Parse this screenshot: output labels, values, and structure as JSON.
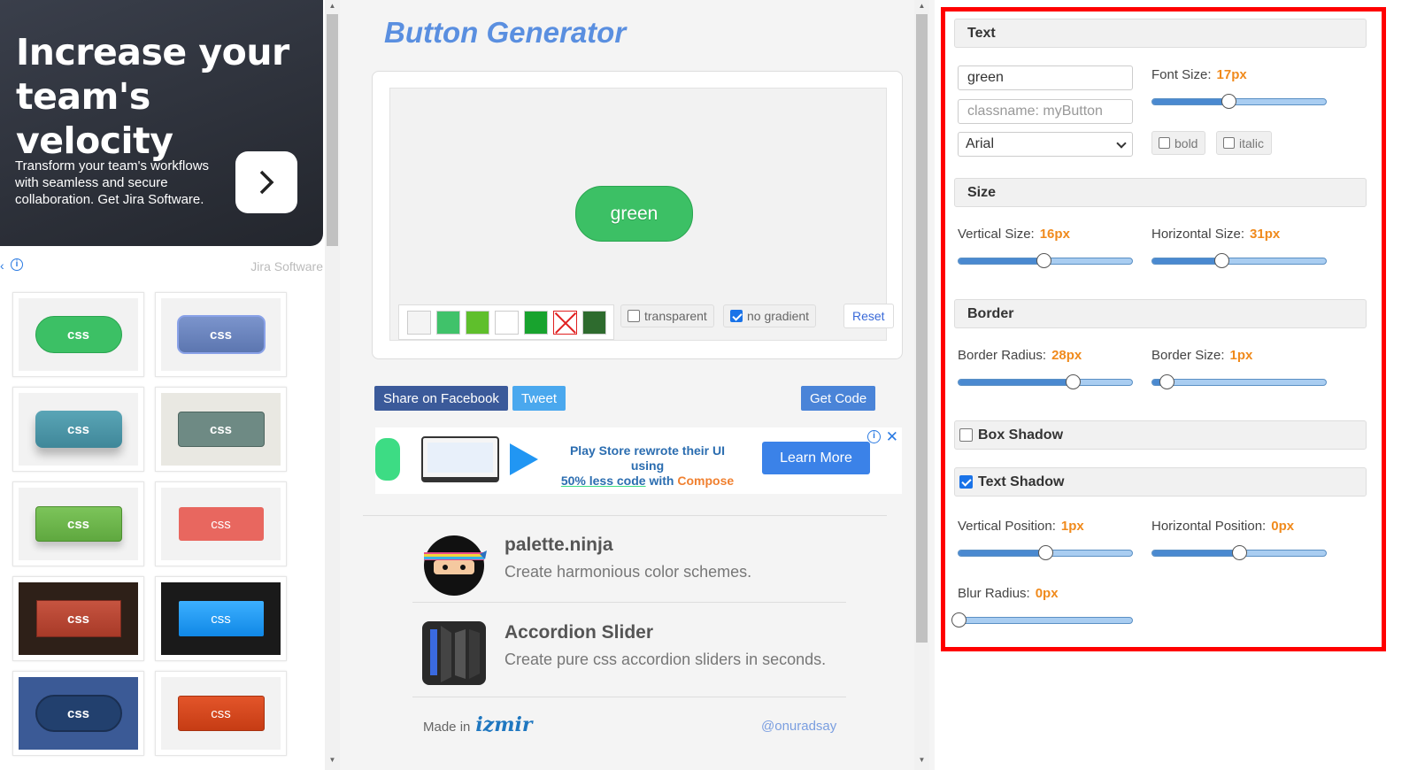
{
  "ad": {
    "headline": "Increase your team's velocity",
    "body": "Transform your team's workflows with seamless and secure collaboration. Get Jira Software.",
    "brand": "Jira Software"
  },
  "presets": [
    {
      "label": "css",
      "bg": "#3cc065"
    },
    {
      "label": "css",
      "bg": "#6a86c0"
    },
    {
      "label": "css",
      "bg": "#4a96a8"
    },
    {
      "label": "css",
      "bg": "#6e8a84"
    },
    {
      "label": "css",
      "bg": "#6fb94e"
    },
    {
      "label": "css",
      "bg": "#e8675f"
    },
    {
      "label": "css",
      "bg": "#b8432f"
    },
    {
      "label": "css",
      "bg": "#1e98f0"
    },
    {
      "label": "css",
      "bg": "#2a4474"
    },
    {
      "label": "css",
      "bg": "#d6451e"
    }
  ],
  "header": {
    "title": "Button Generator"
  },
  "preview": {
    "button_text": "green",
    "swatches": [
      "#f4f4f4",
      "#40c26a",
      "#5fbf2c",
      "#ffffff",
      "#18a32e",
      "#ffffff",
      "#2e6b2e"
    ],
    "transparent_label": "transparent",
    "no_gradient_label": "no gradient",
    "reset_label": "Reset"
  },
  "actions": {
    "facebook": "Share on Facebook",
    "tweet": "Tweet",
    "get_code": "Get Code"
  },
  "banner": {
    "line1": "Play Store rewrote their UI using",
    "highlight": "50% less code",
    "with": "with",
    "compose": "Compose",
    "cta": "Learn More"
  },
  "promos": [
    {
      "name": "palette.ninja",
      "desc": "Create harmonious color schemes."
    },
    {
      "name": "Accordion Slider",
      "desc": "Create pure css accordion sliders in seconds."
    }
  ],
  "footer": {
    "made_in": "Made in",
    "logo": "izmir",
    "handle": "@onuradsay"
  },
  "settings": {
    "text": {
      "heading": "Text",
      "value": "green",
      "classname_placeholder": "classname: myButton",
      "font": "Arial",
      "font_size_label": "Font Size:",
      "font_size": "17px",
      "bold_label": "bold",
      "italic_label": "italic",
      "font_size_fraction": 0.44
    },
    "size": {
      "heading": "Size",
      "vertical_label": "Vertical Size:",
      "vertical": "16px",
      "horizontal_label": "Horizontal Size:",
      "horizontal": "31px",
      "vertical_fraction": 0.49,
      "horizontal_fraction": 0.4
    },
    "border": {
      "heading": "Border",
      "radius_label": "Border Radius:",
      "radius": "28px",
      "size_label": "Border Size:",
      "size": "1px",
      "radius_fraction": 0.66,
      "size_fraction": 0.08
    },
    "box_shadow": {
      "heading": "Box Shadow",
      "enabled": false
    },
    "text_shadow": {
      "heading": "Text Shadow",
      "enabled": true,
      "vpos_label": "Vertical Position:",
      "vpos": "1px",
      "hpos_label": "Horizontal Position:",
      "hpos": "0px",
      "blur_label": "Blur Radius:",
      "blur": "0px",
      "vpos_fraction": 0.5,
      "hpos_fraction": 0.5,
      "blur_fraction": 0.0
    }
  }
}
